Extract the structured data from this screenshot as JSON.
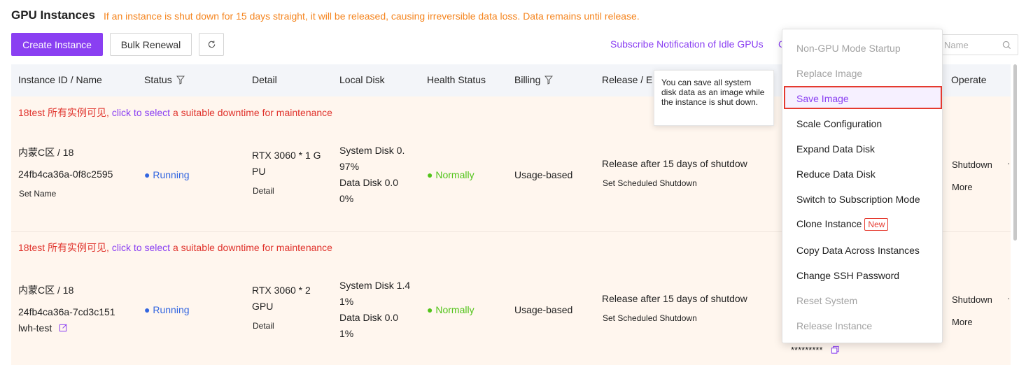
{
  "header": {
    "title": "GPU Instances",
    "warning": "If an instance is shut down for 15 days straight, it will be released, causing irreversible data loss. Data remains until release."
  },
  "toolbar": {
    "create_label": "Create Instance",
    "bulk_label": "Bulk Renewal",
    "refresh_icon": "refresh-icon",
    "subscribe_label": "Subscribe Notification of Idle GPUs",
    "subscribe_partial": "C",
    "search_placeholder": "Name"
  },
  "table": {
    "columns": [
      "Instance ID / Name",
      "Status",
      "Detail",
      "Local Disk",
      "Health Status",
      "Billing",
      "Release / E",
      "Operate"
    ],
    "maintenance": {
      "prefix": "18test 所有实例可见, ",
      "link": "click to select",
      "suffix": " a suitable downtime for maintenance"
    },
    "rows": [
      {
        "region": "内蒙C区 / 18",
        "id": "24fb4ca36a-0f8c2595",
        "name_action": "Set Name",
        "status": "Running",
        "detail_line1": "RTX 3060 * 1 G",
        "detail_line2": "PU",
        "detail_link": "Detail",
        "disk_1": "System Disk 0.",
        "disk_2": "97%",
        "disk_3": "Data Disk 0.0",
        "disk_4": "0%",
        "health": "Normally",
        "billing": "Usage-based",
        "release": "Release after 15 days of shutdow",
        "release_link": "Set Scheduled Shutdown",
        "op_shutdown": "Shutdown",
        "op_more": "More"
      },
      {
        "region": "内蒙C区 / 18",
        "id": "24fb4ca36a-7cd3c151",
        "name": "lwh-test",
        "status": "Running",
        "detail_line1": "RTX 3060 * 2",
        "detail_line2": "GPU",
        "detail_link": "Detail",
        "disk_1": "System Disk 1.4",
        "disk_2": "1%",
        "disk_3": "Data Disk 0.0",
        "disk_4": "1%",
        "health": "Normally",
        "billing": "Usage-based",
        "release": "Release after 15 days of shutdow",
        "release_link": "Set Scheduled Shutdown",
        "op_shutdown": "Shutdown",
        "op_more": "More",
        "password_mask": "*********"
      }
    ]
  },
  "tooltip": {
    "text": "You can save all system disk data as an image while the instance is shut down."
  },
  "menu": {
    "items": [
      {
        "label": "Non-GPU Mode Startup",
        "disabled": true
      },
      {
        "label": "Replace Image",
        "disabled": true
      },
      {
        "label": "Save Image",
        "disabled": false,
        "highlighted": true
      },
      {
        "label": "Scale Configuration",
        "disabled": false
      },
      {
        "label": "Expand Data Disk",
        "disabled": false
      },
      {
        "label": "Reduce Data Disk",
        "disabled": false
      },
      {
        "label": "Switch to Subscription Mode",
        "disabled": false
      },
      {
        "label": "Clone Instance",
        "disabled": false,
        "badge": "New"
      },
      {
        "label": "Copy Data Across Instances",
        "disabled": false
      },
      {
        "label": "Change SSH Password",
        "disabled": false
      },
      {
        "label": "Reset System",
        "disabled": true
      },
      {
        "label": "Release Instance",
        "disabled": true
      }
    ]
  },
  "colors": {
    "accent": "#8a3ff2",
    "warning": "#f5851f",
    "danger": "#e53a2f",
    "running": "#3366e0",
    "normal": "#52c41a"
  }
}
